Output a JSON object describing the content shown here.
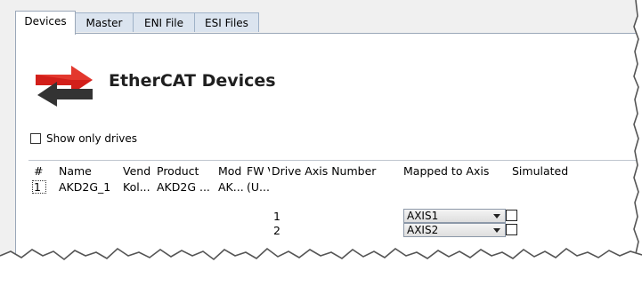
{
  "tabs": [
    {
      "label": "Devices"
    },
    {
      "label": "Master"
    },
    {
      "label": "ENI File"
    },
    {
      "label": "ESI Files"
    }
  ],
  "header": {
    "title": "EtherCAT Devices",
    "icon": "ethercat-exchange-arrows-icon"
  },
  "filter": {
    "show_only_drives_label": "Show only drives",
    "checked": false
  },
  "table": {
    "columns": [
      "#",
      "Name",
      "Vend",
      "Product",
      "Mod",
      "FW V",
      "Drive Axis Number",
      "Mapped to Axis",
      "Simulated"
    ],
    "rows": [
      {
        "index": "1",
        "name": "AKD2G_1",
        "vendor": "Kol...",
        "product": "AKD2G ...",
        "module": "AK...",
        "fw": "(U...",
        "axes": [
          {
            "drive_axis_number": "1",
            "mapped_to_axis": "AXIS1",
            "simulated": false
          },
          {
            "drive_axis_number": "2",
            "mapped_to_axis": "AXIS2",
            "simulated": false
          }
        ]
      }
    ]
  },
  "colors": {
    "tab_inactive": "#dbe4ef",
    "panel_bg": "#f0f0f0",
    "title_red": "#d21f1a",
    "arrow_dark": "#333333"
  }
}
